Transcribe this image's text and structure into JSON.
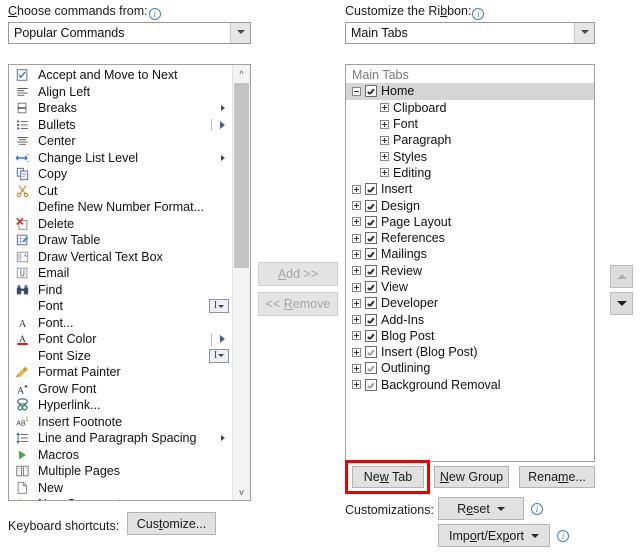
{
  "left_panel": {
    "label": "Choose commands from:",
    "info_icon": "info-icon",
    "combo_value": "Popular Commands",
    "commands": [
      {
        "label": "Accept and Move to Next",
        "icon": "accept-change-icon",
        "trailing": "none"
      },
      {
        "label": "Align Left",
        "icon": "align-left-icon",
        "trailing": "none"
      },
      {
        "label": "Breaks",
        "icon": "breaks-icon",
        "trailing": "submenu-arrow"
      },
      {
        "label": "Bullets",
        "icon": "bullets-icon",
        "trailing": "split-arrow"
      },
      {
        "label": "Center",
        "icon": "align-center-icon",
        "trailing": "none"
      },
      {
        "label": "Change List Level",
        "icon": "change-list-level-icon",
        "trailing": "submenu-arrow"
      },
      {
        "label": "Copy",
        "icon": "copy-icon",
        "trailing": "none"
      },
      {
        "label": "Cut",
        "icon": "cut-scissors-icon",
        "trailing": "none"
      },
      {
        "label": "Define New Number Format...",
        "icon": "none",
        "trailing": "none"
      },
      {
        "label": "Delete",
        "icon": "delete-x-icon",
        "trailing": "none"
      },
      {
        "label": "Draw Table",
        "icon": "draw-table-icon",
        "trailing": "none"
      },
      {
        "label": "Draw Vertical Text Box",
        "icon": "draw-vertical-text-box-icon",
        "trailing": "none"
      },
      {
        "label": "Email",
        "icon": "email-attachment-icon",
        "trailing": "none"
      },
      {
        "label": "Find",
        "icon": "find-binoculars-icon",
        "trailing": "none"
      },
      {
        "label": "Font",
        "icon": "none",
        "trailing": "combo-mark"
      },
      {
        "label": "Font...",
        "icon": "font-a-icon",
        "trailing": "none"
      },
      {
        "label": "Font Color",
        "icon": "font-color-a-icon",
        "trailing": "split-arrow"
      },
      {
        "label": "Font Size",
        "icon": "none",
        "trailing": "combo-mark"
      },
      {
        "label": "Format Painter",
        "icon": "format-painter-brush-icon",
        "trailing": "none"
      },
      {
        "label": "Grow Font",
        "icon": "grow-font-icon",
        "trailing": "none"
      },
      {
        "label": "Hyperlink...",
        "icon": "hyperlink-chain-icon",
        "trailing": "none"
      },
      {
        "label": "Insert Footnote",
        "icon": "insert-footnote-icon",
        "trailing": "none"
      },
      {
        "label": "Line and Paragraph Spacing",
        "icon": "line-spacing-icon",
        "trailing": "submenu-arrow"
      },
      {
        "label": "Macros",
        "icon": "macros-play-icon",
        "trailing": "none"
      },
      {
        "label": "Multiple Pages",
        "icon": "multiple-pages-icon",
        "trailing": "none"
      },
      {
        "label": "New",
        "icon": "new-document-icon",
        "trailing": "none"
      },
      {
        "label": "New Comment",
        "icon": "new-comment-icon",
        "trailing": "none"
      }
    ]
  },
  "center": {
    "add_label": "Add >>",
    "add_enabled": false,
    "remove_label": "<< Remove",
    "remove_enabled": false
  },
  "right_panel": {
    "label": "Customize the Ribbon:",
    "info_icon": "info-icon",
    "combo_value": "Main Tabs",
    "tree_header": "Main Tabs",
    "tree": [
      {
        "label": "Home",
        "level": 0,
        "expander": "minus",
        "checkbox": "checked",
        "selected": true
      },
      {
        "label": "Clipboard",
        "level": 1,
        "expander": "plus",
        "checkbox": "none",
        "selected": false
      },
      {
        "label": "Font",
        "level": 1,
        "expander": "plus",
        "checkbox": "none",
        "selected": false
      },
      {
        "label": "Paragraph",
        "level": 1,
        "expander": "plus",
        "checkbox": "none",
        "selected": false
      },
      {
        "label": "Styles",
        "level": 1,
        "expander": "plus",
        "checkbox": "none",
        "selected": false
      },
      {
        "label": "Editing",
        "level": 1,
        "expander": "plus",
        "checkbox": "none",
        "selected": false
      },
      {
        "label": "Insert",
        "level": 0,
        "expander": "plus",
        "checkbox": "checked",
        "selected": false
      },
      {
        "label": "Design",
        "level": 0,
        "expander": "plus",
        "checkbox": "checked",
        "selected": false
      },
      {
        "label": "Page Layout",
        "level": 0,
        "expander": "plus",
        "checkbox": "checked",
        "selected": false
      },
      {
        "label": "References",
        "level": 0,
        "expander": "plus",
        "checkbox": "checked",
        "selected": false
      },
      {
        "label": "Mailings",
        "level": 0,
        "expander": "plus",
        "checkbox": "checked",
        "selected": false
      },
      {
        "label": "Review",
        "level": 0,
        "expander": "plus",
        "checkbox": "checked",
        "selected": false
      },
      {
        "label": "View",
        "level": 0,
        "expander": "plus",
        "checkbox": "checked",
        "selected": false
      },
      {
        "label": "Developer",
        "level": 0,
        "expander": "plus",
        "checkbox": "checked",
        "selected": false
      },
      {
        "label": "Add-Ins",
        "level": 0,
        "expander": "plus",
        "checkbox": "checked",
        "selected": false
      },
      {
        "label": "Blog Post",
        "level": 0,
        "expander": "plus",
        "checkbox": "checked",
        "selected": false
      },
      {
        "label": "Insert (Blog Post)",
        "level": 0,
        "expander": "plus",
        "checkbox": "checked-dim",
        "selected": false
      },
      {
        "label": "Outlining",
        "level": 0,
        "expander": "plus",
        "checkbox": "checked-dim",
        "selected": false
      },
      {
        "label": "Background Removal",
        "level": 0,
        "expander": "plus",
        "checkbox": "checked-dim",
        "selected": false
      }
    ],
    "move_up_icon": "move-up-arrow-icon",
    "move_down_icon": "move-down-arrow-icon",
    "move_up_enabled": false,
    "move_down_enabled": true,
    "new_tab_label": "New Tab",
    "new_group_label": "New Group",
    "rename_label": "Rename...",
    "new_tab_highlighted": true,
    "highlight_color": "#ee0000",
    "customizations_label": "Customizations:",
    "reset_label": "Reset",
    "import_export_label": "Import/Export"
  },
  "bottom_left": {
    "keyboard_label": "Keyboard shortcuts:",
    "customize_label": "Customize..."
  }
}
